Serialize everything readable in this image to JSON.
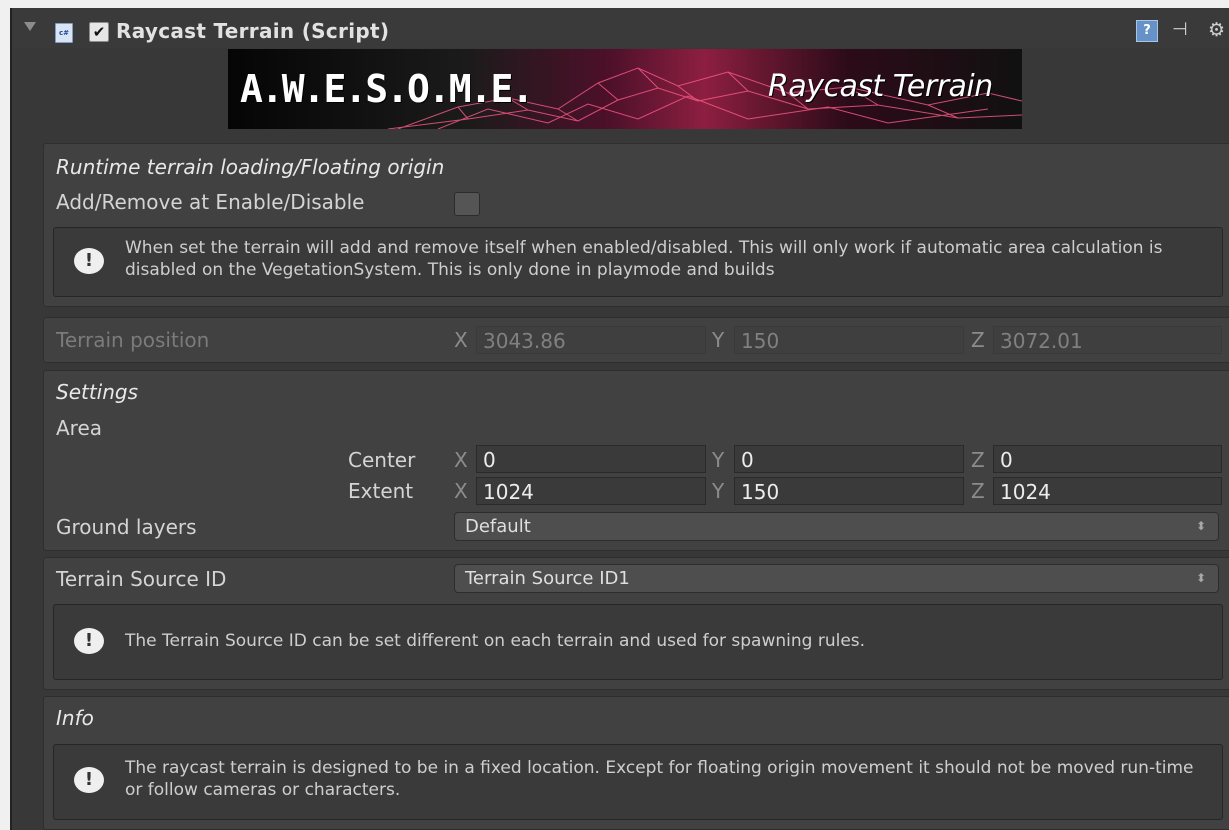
{
  "component": {
    "title": "Raycast Terrain (Script)",
    "enabled_check": "✔",
    "script_icon_text": "c#",
    "help_icon_text": "?",
    "preset_icon_text": "⊣",
    "gear_icon_text": "⚙"
  },
  "banner": {
    "logo": "A.W.E.S.O.M.E.",
    "title": "Raycast Terrain"
  },
  "runtime": {
    "title": "Runtime terrain loading/Floating origin",
    "add_remove_label": "Add/Remove at Enable/Disable",
    "add_remove_checked": false,
    "help_text": "When set the terrain will add and remove itself when enabled/disabled. This will only work if automatic area calculation is disabled on the VegetationSystem. This is only done in playmode and builds"
  },
  "terrain_position": {
    "label": "Terrain position",
    "x_label": "X",
    "y_label": "Y",
    "z_label": "Z",
    "x": "3043.86",
    "y": "150",
    "z": "3072.01"
  },
  "settings": {
    "title": "Settings",
    "area_label": "Area",
    "center_label": "Center",
    "extent_label": "Extent",
    "center": {
      "x": "0",
      "y": "0",
      "z": "0"
    },
    "extent": {
      "x": "1024",
      "y": "150",
      "z": "1024"
    },
    "x_label": "X",
    "y_label": "Y",
    "z_label": "Z",
    "ground_layers_label": "Ground layers",
    "ground_layers_value": "Default"
  },
  "terrain_source": {
    "label": "Terrain Source ID",
    "value": "Terrain Source ID1",
    "help_text": "The Terrain Source ID can be set different on each terrain and used for spawning rules."
  },
  "info": {
    "title": "Info",
    "help_text": "The raycast terrain is designed to be in a fixed location. Except for floating origin movement it should not be moved run-time or follow cameras or characters."
  },
  "icons": {
    "foldout": "chevron-down-icon",
    "script": "csharp-script-icon",
    "help": "help-icon",
    "preset": "preset-icon",
    "settings": "gear-icon",
    "warning": "exclamation-icon"
  }
}
